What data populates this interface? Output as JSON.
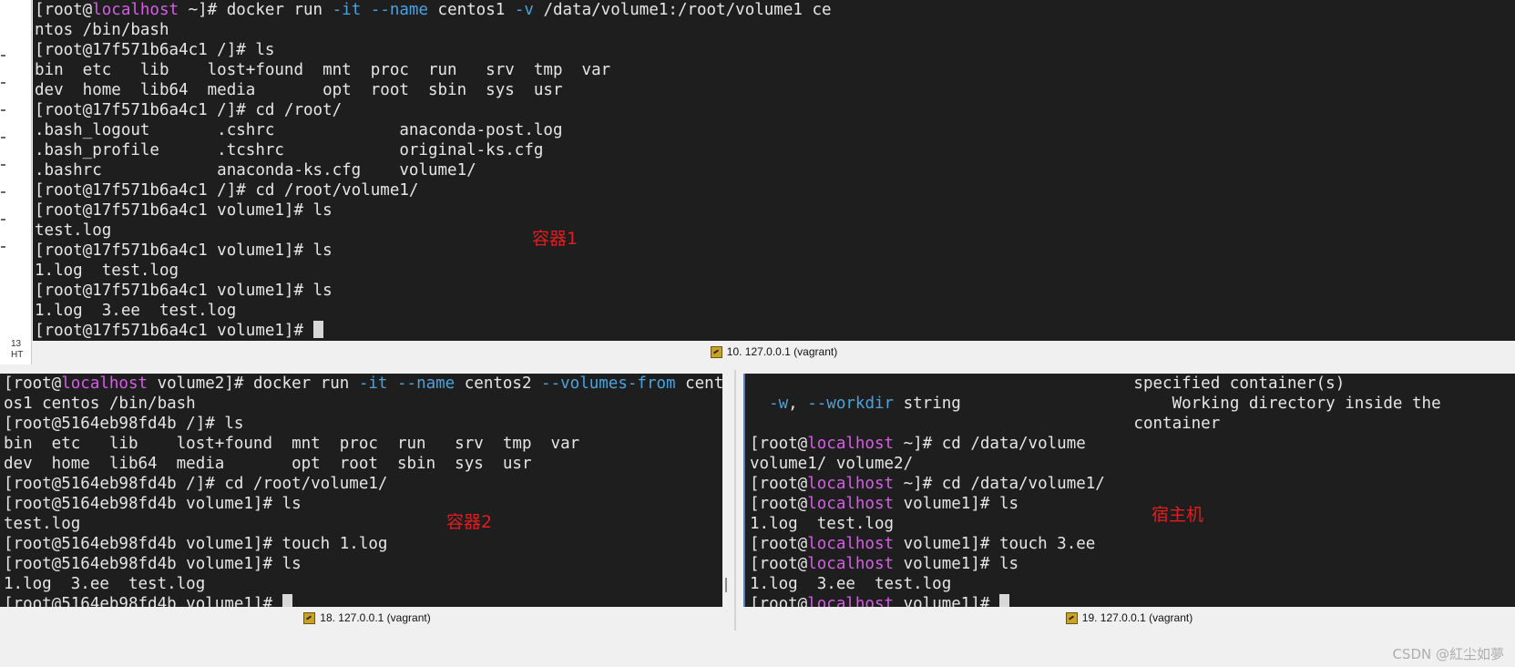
{
  "pane1": {
    "lines": [
      [
        {
          "t": "[root@"
        },
        {
          "t": "localhost",
          "c": "host"
        },
        {
          "t": " ~]# docker run "
        },
        {
          "t": "-it",
          "c": "opt"
        },
        {
          "t": " "
        },
        {
          "t": "--name",
          "c": "opt"
        },
        {
          "t": " centos1 "
        },
        {
          "t": "-v",
          "c": "opt"
        },
        {
          "t": " /data/volume1:/root/volume1 ce"
        }
      ],
      [
        {
          "t": "ntos /bin/bash"
        }
      ],
      [
        {
          "t": "[root@17f571b6a4c1 /]# ls"
        }
      ],
      [
        {
          "t": "bin  etc   lib    lost+found  mnt  proc  run   srv  tmp  var"
        }
      ],
      [
        {
          "t": "dev  home  lib64  media       opt  root  sbin  sys  usr"
        }
      ],
      [
        {
          "t": "[root@17f571b6a4c1 /]# cd /root/"
        }
      ],
      [
        {
          "t": ".bash_logout       .cshrc             anaconda-post.log"
        }
      ],
      [
        {
          "t": ".bash_profile      .tcshrc            original-ks.cfg"
        }
      ],
      [
        {
          "t": ".bashrc            anaconda-ks.cfg    volume1/"
        }
      ],
      [
        {
          "t": "[root@17f571b6a4c1 /]# cd /root/volume1/"
        }
      ],
      [
        {
          "t": "[root@17f571b6a4c1 volume1]# ls"
        }
      ],
      [
        {
          "t": "test.log"
        }
      ],
      [
        {
          "t": "[root@17f571b6a4c1 volume1]# ls"
        }
      ],
      [
        {
          "t": "1.log  test.log"
        }
      ],
      [
        {
          "t": "[root@17f571b6a4c1 volume1]# ls"
        }
      ],
      [
        {
          "t": "1.log  3.ee  test.log"
        }
      ],
      [
        {
          "t": "[root@17f571b6a4c1 volume1]# "
        },
        {
          "cursor": true
        }
      ]
    ],
    "label": "容器1",
    "status": "10. 127.0.0.1 (vagrant)"
  },
  "pane2": {
    "lines": [
      [
        {
          "t": "[root@"
        },
        {
          "t": "localhost",
          "c": "host"
        },
        {
          "t": " volume2]# docker run "
        },
        {
          "t": "-it",
          "c": "opt"
        },
        {
          "t": " "
        },
        {
          "t": "--name",
          "c": "opt"
        },
        {
          "t": " centos2 "
        },
        {
          "t": "--volumes-from",
          "c": "opt"
        },
        {
          "t": " cent"
        }
      ],
      [
        {
          "t": "os1 centos /bin/bash"
        }
      ],
      [
        {
          "t": "[root@5164eb98fd4b /]# ls"
        }
      ],
      [
        {
          "t": "bin  etc   lib    lost+found  mnt  proc  run   srv  tmp  var"
        }
      ],
      [
        {
          "t": "dev  home  lib64  media       opt  root  sbin  sys  usr"
        }
      ],
      [
        {
          "t": "[root@5164eb98fd4b /]# cd /root/volume1/"
        }
      ],
      [
        {
          "t": "[root@5164eb98fd4b volume1]# ls"
        }
      ],
      [
        {
          "t": "test.log"
        }
      ],
      [
        {
          "t": "[root@5164eb98fd4b volume1]# touch 1.log"
        }
      ],
      [
        {
          "t": "[root@5164eb98fd4b volume1]# ls"
        }
      ],
      [
        {
          "t": "1.log  3.ee  test.log"
        }
      ],
      [
        {
          "t": "[root@5164eb98fd4b volume1]# "
        },
        {
          "cursor": true
        }
      ]
    ],
    "label": "容器2",
    "status": "18. 127.0.0.1 (vagrant)"
  },
  "pane3": {
    "lines": [
      [
        {
          "t": "                                        specified container(s)"
        }
      ],
      [
        {
          "t": "  "
        },
        {
          "t": "-w",
          "c": "opt"
        },
        {
          "t": ", "
        },
        {
          "t": "--workdir",
          "c": "opt"
        },
        {
          "t": " string                      Working directory inside the"
        }
      ],
      [
        {
          "t": "                                        container"
        }
      ],
      [
        {
          "t": "[root@"
        },
        {
          "t": "localhost",
          "c": "host"
        },
        {
          "t": " ~]# cd /data/volume"
        }
      ],
      [
        {
          "t": "volume1/ volume2/"
        }
      ],
      [
        {
          "t": "[root@"
        },
        {
          "t": "localhost",
          "c": "host"
        },
        {
          "t": " ~]# cd /data/volume1/"
        }
      ],
      [
        {
          "t": "[root@"
        },
        {
          "t": "localhost",
          "c": "host"
        },
        {
          "t": " volume1]# ls"
        }
      ],
      [
        {
          "t": "1.log  test.log"
        }
      ],
      [
        {
          "t": "[root@"
        },
        {
          "t": "localhost",
          "c": "host"
        },
        {
          "t": " volume1]# touch 3.ee"
        }
      ],
      [
        {
          "t": "[root@"
        },
        {
          "t": "localhost",
          "c": "host"
        },
        {
          "t": " volume1]# ls"
        }
      ],
      [
        {
          "t": "1.log  3.ee  test.log"
        }
      ],
      [
        {
          "t": "[root@"
        },
        {
          "t": "localhost",
          "c": "host"
        },
        {
          "t": " volume1]# "
        },
        {
          "cursor": true
        }
      ]
    ],
    "label": "宿主机",
    "status": "19. 127.0.0.1 (vagrant)"
  },
  "left_edge": {
    "text1": "13",
    "text2": "HT"
  },
  "watermark": "CSDN @紅尘如夢",
  "colors": {
    "host": "#d65ee6",
    "opt": "#4aa3df",
    "annotation": "#e01f1f",
    "terminal_bg": "#1e1e1e"
  },
  "icons": {
    "status": "session-icon"
  }
}
